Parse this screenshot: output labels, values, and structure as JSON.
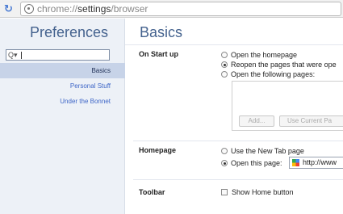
{
  "address_bar": {
    "reload_icon": "reload-icon",
    "url_scheme": "chrome://",
    "url_host": "settings",
    "url_path": "/browser"
  },
  "sidebar": {
    "title": "Preferences",
    "search_value": "",
    "items": [
      {
        "label": "Basics",
        "active": true
      },
      {
        "label": "Personal Stuff",
        "active": false
      },
      {
        "label": "Under the Bonnet",
        "active": false
      }
    ]
  },
  "main": {
    "title": "Basics",
    "startup": {
      "label": "On Start up",
      "options": [
        {
          "label": "Open the homepage",
          "selected": false
        },
        {
          "label": "Reopen the pages that were ope",
          "selected": true
        },
        {
          "label": "Open the following pages:",
          "selected": false
        }
      ],
      "add_button": "Add...",
      "use_current_button": "Use Current Pa"
    },
    "homepage": {
      "label": "Homepage",
      "options": [
        {
          "label": "Use the New Tab page",
          "selected": false
        },
        {
          "label": "Open this page:",
          "selected": true
        }
      ],
      "url_value": "http://www"
    },
    "toolbar": {
      "label": "Toolbar",
      "show_home_button": {
        "label": "Show Home button",
        "checked": false
      }
    }
  },
  "colors": {
    "heading": "#44628e",
    "link": "#3e66c7",
    "sidebar_bg": "#edf1f7",
    "active_item_bg": "#c7d3e8"
  }
}
